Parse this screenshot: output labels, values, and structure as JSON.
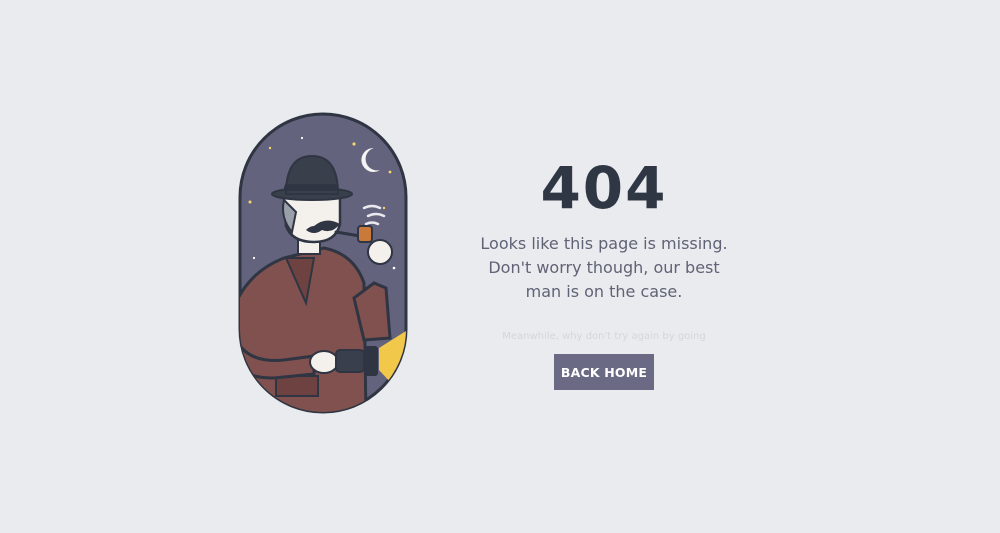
{
  "error": {
    "code": "404",
    "message_lines": [
      "Looks like this page is missing.",
      "Don't worry though, our best",
      "man is on the case."
    ],
    "note": "Meanwhile, why don't try again by going"
  },
  "actions": {
    "back_home_label": "BACK HOME"
  },
  "illustration": {
    "icon": "detective-icon",
    "colors": {
      "background": "#e9ebee",
      "sky": "#63637d",
      "coat": "#80514e",
      "hat": "#3a404b",
      "button": "#6b6a85"
    }
  }
}
